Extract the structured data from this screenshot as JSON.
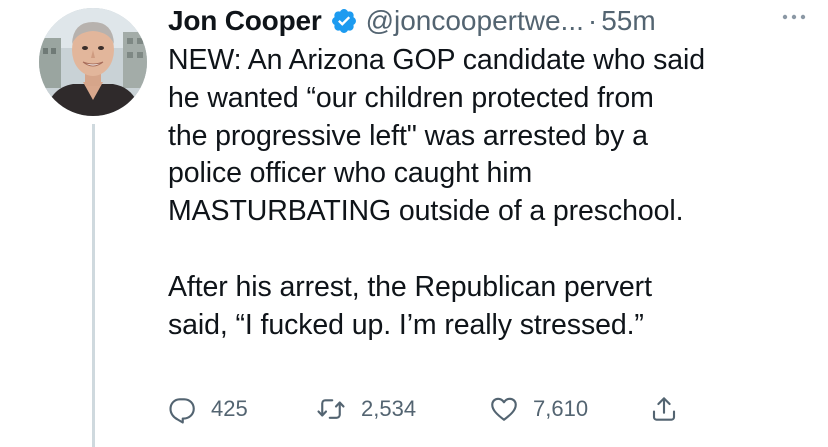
{
  "author": {
    "name": "Jon Cooper",
    "handle": "@joncoopertwe...",
    "separator": "·",
    "time": "55m"
  },
  "icons": {
    "verified": "verified-badge-icon",
    "more": "more-options-icon",
    "reply": "reply-icon",
    "retweet": "retweet-icon",
    "like": "like-icon",
    "share": "share-icon"
  },
  "tweet": {
    "paragraph_1": "NEW: An Arizona GOP candidate who said\nhe wanted “our children protected from\nthe progressive left\" was arrested by a\npolice officer who caught him\nMASTURBATING outside of a preschool.",
    "paragraph_2": "After his arrest, the Republican pervert\nsaid, “I fucked up. I’m really stressed.”"
  },
  "stats": {
    "replies": "425",
    "retweets": "2,534",
    "likes": "7,610"
  },
  "colors": {
    "verified": "#1d9bf0",
    "secondary_text": "#536471",
    "thread_line": "#cfd9de"
  }
}
